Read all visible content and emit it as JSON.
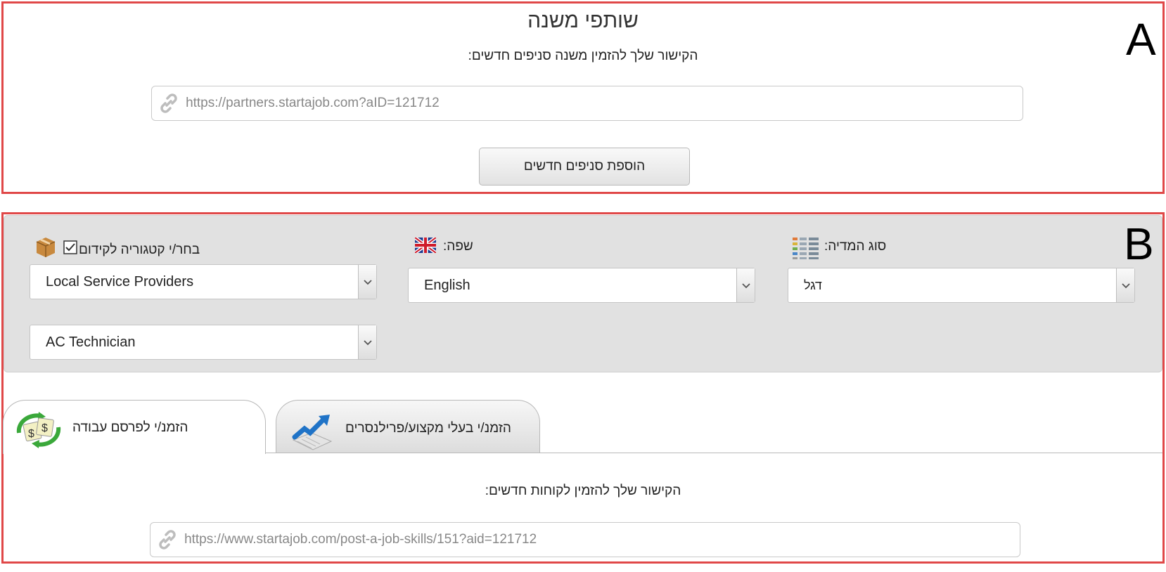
{
  "section_a": {
    "title": "שותפי משנה",
    "subtitle": "הקישור שלך להזמין משנה סניפים חדשים:",
    "link_value": "https://partners.startajob.com?aID=121712",
    "add_button_label": "הוספת סניפים חדשים",
    "marker": "A"
  },
  "section_b": {
    "marker": "B",
    "media_type": {
      "label": "סוג המדיה:",
      "value": "דגל",
      "icon": "list-icon"
    },
    "language": {
      "label": "שפה:",
      "value": "English",
      "icon": "uk-flag-icon"
    },
    "category": {
      "label": "בחר/י קטגוריה לקידום",
      "checkbox_checked": true,
      "icon": "box-icon",
      "value": "Local Service Providers",
      "subcategory_value": "AC Technician"
    },
    "tabs": [
      {
        "label": "הזמנ/י לפרסם עבודה",
        "icon": "money-exchange-icon",
        "active": true
      },
      {
        "label": "הזמנ/י בעלי מקצוע/פרילנסרים",
        "icon": "growth-chart-icon",
        "active": false
      }
    ],
    "client_subtitle": "הקישור שלך להזמין לקוחות חדשים:",
    "client_link_value": "https://www.startajob.com/post-a-job-skills/151?aid=121712"
  },
  "colors": {
    "highlight_border": "#e04848",
    "panel_bg": "#e1e1e1"
  }
}
